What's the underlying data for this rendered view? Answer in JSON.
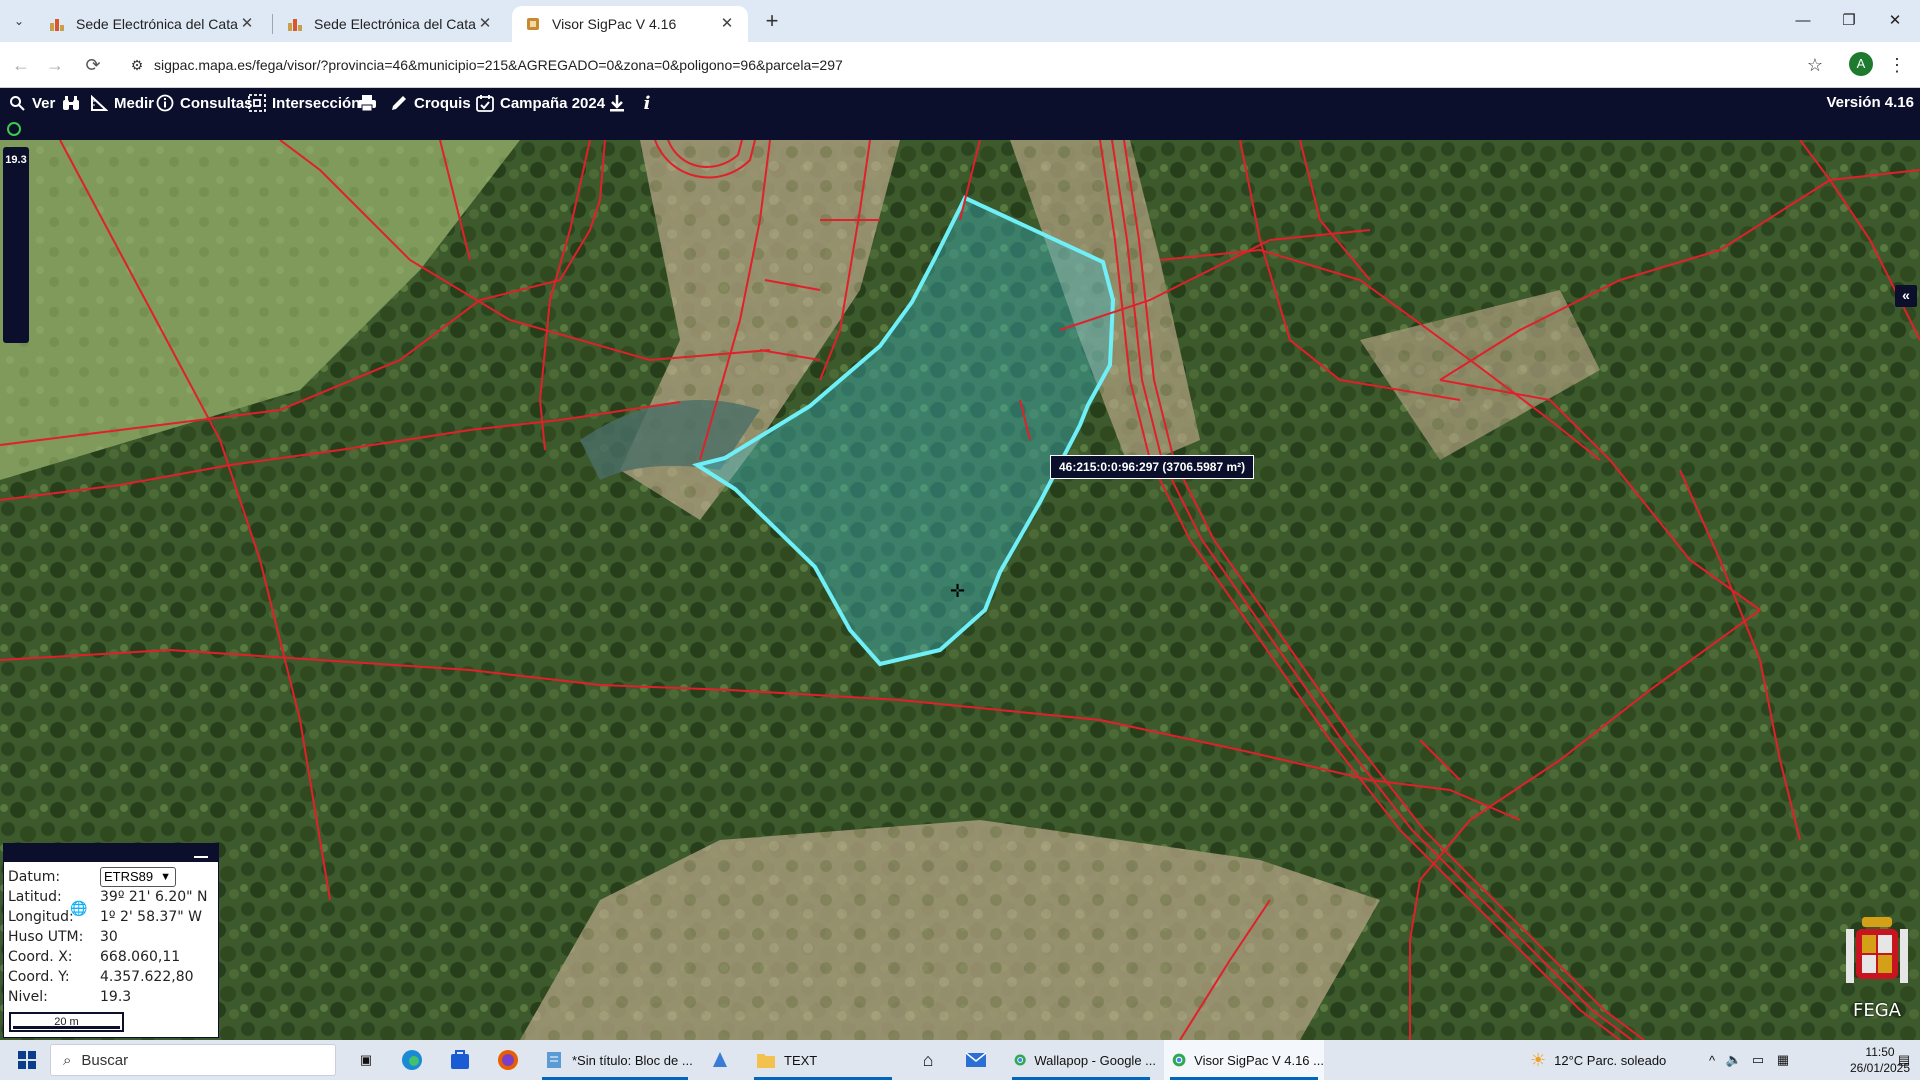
{
  "browser": {
    "tabs": [
      {
        "label": "Sede Electrónica del Catastro - ",
        "active": false
      },
      {
        "label": "Sede Electrónica del Catastro",
        "active": false
      },
      {
        "label": "Visor SigPac V 4.16",
        "active": true
      }
    ],
    "url": "sigpac.mapa.es/fega/visor/?provincia=46&municipio=215&AGREGADO=0&zona=0&poligono=96&parcela=297",
    "profile_initial": "A",
    "window_controls": {
      "minimize": "—",
      "restore": "❐",
      "close": "✕"
    }
  },
  "toolbar": {
    "ver": "Ver",
    "medir": "Medir",
    "consultas": "Consultas",
    "interseccion": "Intersección",
    "croquis": "Croquis",
    "campana": "Campaña 2024",
    "version": "Versión 4.16"
  },
  "map": {
    "zoom_level": "19.3",
    "parcel_tooltip": "46:215:0:0:96:297 (3706.5987 m²)",
    "highlight_color": "#5fe6f0",
    "boundary_color": "#e0202a"
  },
  "coords": {
    "datum_label": "Datum:",
    "datum_value": "ETRS89",
    "lat_label": "Latitud:",
    "lat_value": "39º 21' 6.20\" N",
    "lon_label": "Longitud:",
    "lon_value": "1º 2' 58.37\" W",
    "huso_label": "Huso UTM:",
    "huso_value": "30",
    "x_label": "Coord. X:",
    "x_value": "668.060,11",
    "y_label": "Coord. Y:",
    "y_value": "4.357.622,80",
    "nivel_label": "Nivel:",
    "nivel_value": "19.3",
    "scale": "20 m"
  },
  "fega_label": "FEGA",
  "taskbar": {
    "search_placeholder": "Buscar",
    "notepad": "*Sin título: Bloc de ...",
    "folder": "TEXT",
    "chrome1": "Wallapop - Google ...",
    "chrome2": "Visor SigPac V 4.16 ...",
    "weather": "12°C  Parc. soleado",
    "time": "11:50",
    "date": "26/01/2025"
  }
}
